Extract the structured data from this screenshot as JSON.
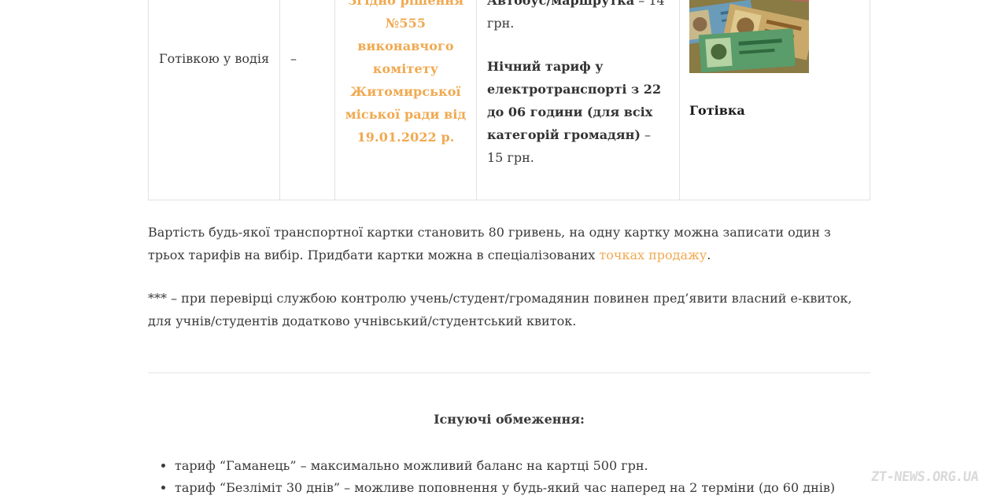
{
  "table": {
    "payment_method": "Готівкою у водія",
    "dash": "–",
    "decision_lines": [
      "Згідно рішення",
      "№555",
      "виконавчого",
      "комітету",
      "Житомирської",
      "міської ради від",
      "19.01.2022 р."
    ],
    "tariff_bus_label": "Автобус/маршрутка",
    "tariff_bus_price": " – 14 грн.",
    "tariff_night_label": "Нічний тариф у електротранспорті з 22 до 06 години (для всіх категорій громадян)",
    "tariff_night_price": " – 15 грн.",
    "cash_label": "Готівка",
    "image_icon": "ukrainian-banknotes-image"
  },
  "paragraph1": {
    "text_before": "Вартість будь-якої транспортної картки становить 80 гривень, на одну картку можна записати один з трьох тарифів на вибір. Придбати картки можна в спеціалізованих ",
    "link": "точках продажу",
    "text_after": "."
  },
  "paragraph2": "*** – при перевірці службою контролю учень/студент/громадянин повинен пред’явити власний е-квиток, для учнів/студентів додатково учнівський/студентський квиток.",
  "limits": {
    "title": "Існуючі обмеження:",
    "items": [
      "тариф “Гаманець” – максимально можливий баланс на картці 500 грн.",
      "тариф “Безліміт 30 днів” – можливе поповнення у будь-який час наперед на 2 терміни (до 60 днів)"
    ]
  },
  "watermark": "ZT-NEWS.ORG.UA",
  "colors": {
    "accent": "#f0a950",
    "text": "#3a3a3a",
    "border": "#e2e2e2"
  }
}
